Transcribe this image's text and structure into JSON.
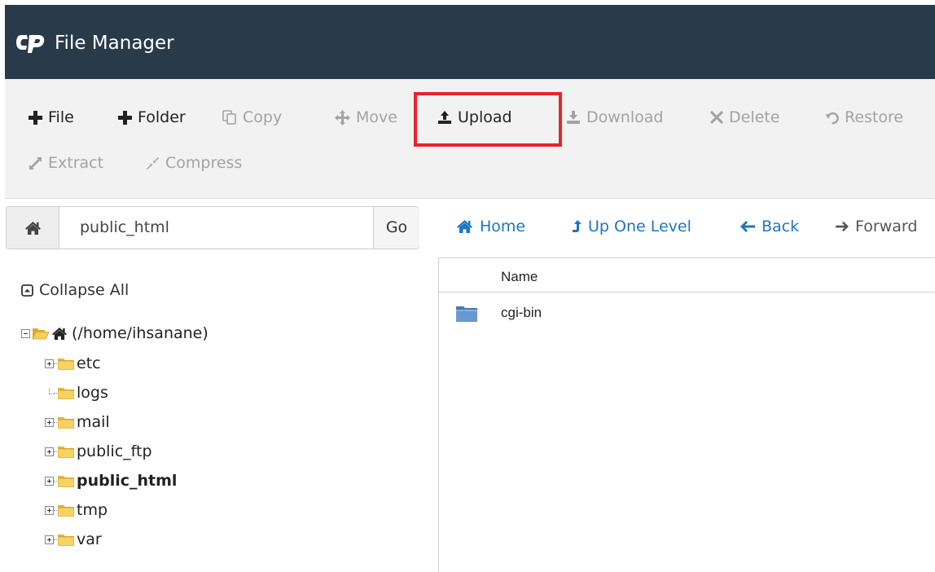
{
  "header": {
    "title": "File Manager",
    "logo": "cP"
  },
  "toolbar": {
    "file": "File",
    "folder": "Folder",
    "copy": "Copy",
    "move": "Move",
    "upload": "Upload",
    "download": "Download",
    "delete": "Delete",
    "restore": "Restore",
    "extract": "Extract",
    "compress": "Compress"
  },
  "pathbar": {
    "value": "public_html",
    "go": "Go"
  },
  "nav": {
    "home": "Home",
    "up": "Up One Level",
    "back": "Back",
    "forward": "Forward"
  },
  "tree": {
    "collapse_all": "Collapse All",
    "root": "(/home/ihsanane)",
    "items": [
      {
        "label": "etc",
        "expandable": true
      },
      {
        "label": "logs",
        "expandable": false
      },
      {
        "label": "mail",
        "expandable": true
      },
      {
        "label": "public_ftp",
        "expandable": true
      },
      {
        "label": "public_html",
        "expandable": true,
        "selected": true
      },
      {
        "label": "tmp",
        "expandable": true
      },
      {
        "label": "var",
        "expandable": true
      }
    ]
  },
  "files": {
    "columns": [
      "Name"
    ],
    "rows": [
      {
        "name": "cgi-bin",
        "type": "folder"
      }
    ]
  },
  "colors": {
    "topbar": "#293a4a",
    "link": "#1c76c2",
    "highlight": "#e8232b",
    "folder": "#f2c94c"
  }
}
